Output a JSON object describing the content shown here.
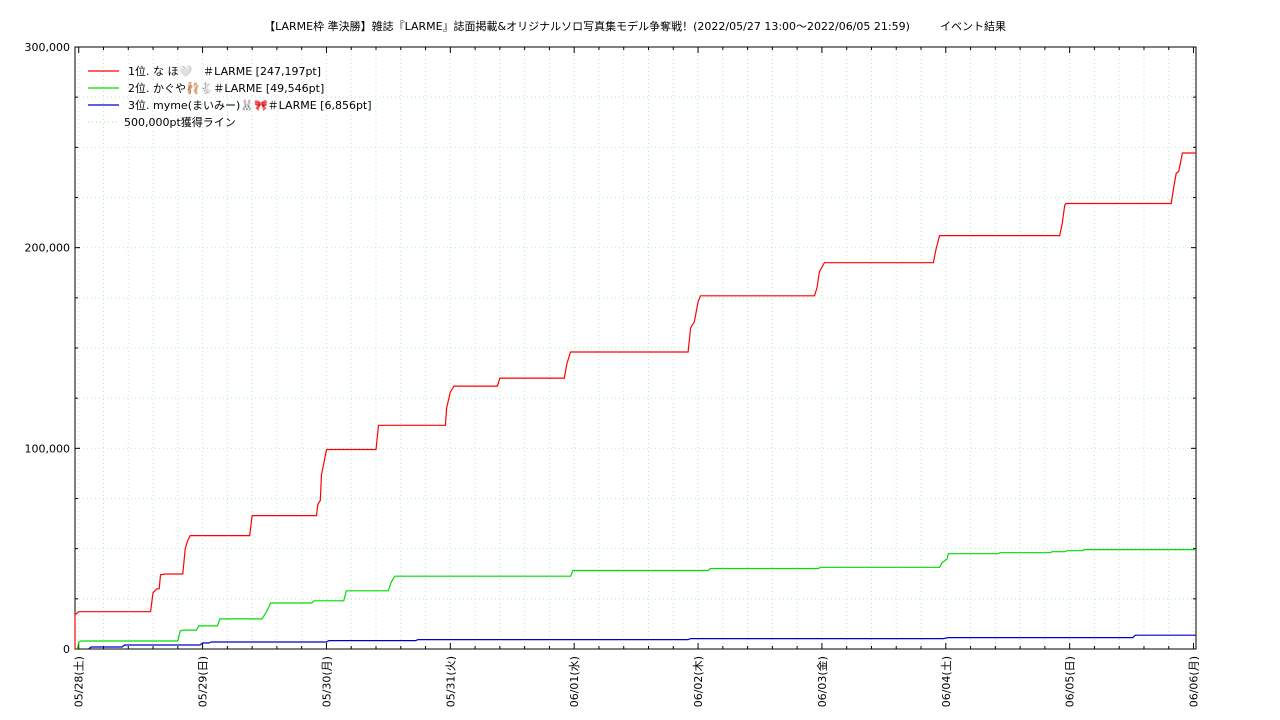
{
  "chart_data": {
    "type": "line",
    "title": "【LARME枠 準決勝】雑誌『LARME』誌面掲載&オリジナルソロ写真集モデル争奪戦！(2022/05/27 13:00～2022/06/05 21:59)",
    "subtitle": "イベント結果",
    "xlabel": "",
    "ylabel": "",
    "ylim": [
      0,
      300000
    ],
    "xlim": [
      -0.03,
      9.02
    ],
    "x_tick_labels": [
      "05/28(土)",
      "05/29(日)",
      "05/30(月)",
      "05/31(火)",
      "06/01(水)",
      "06/02(木)",
      "06/03(金)",
      "06/04(土)",
      "06/05(日)",
      "06/06(月)"
    ],
    "y_ticks": [
      0,
      100000,
      200000,
      300000
    ],
    "y_tick_labels": [
      "0",
      "100,000",
      "200,000",
      "300,000"
    ],
    "grid": true,
    "legend_position": "top-left",
    "series": [
      {
        "name": "1位. な ほ🤍　＃LARME [247,197pt]",
        "color": "#ff0000",
        "points": [
          [
            -0.06,
            0
          ],
          [
            -0.05,
            12000
          ],
          [
            -0.03,
            17000
          ],
          [
            0.0,
            18600
          ],
          [
            0.58,
            18600
          ],
          [
            0.6,
            28000
          ],
          [
            0.63,
            30000
          ],
          [
            0.65,
            30000
          ],
          [
            0.66,
            37000
          ],
          [
            0.7,
            37400
          ],
          [
            0.84,
            37400
          ],
          [
            0.86,
            50000
          ],
          [
            0.88,
            54000
          ],
          [
            0.9,
            56500
          ],
          [
            1.38,
            56500
          ],
          [
            1.4,
            66500
          ],
          [
            1.92,
            66500
          ],
          [
            1.93,
            72000
          ],
          [
            1.95,
            74000
          ],
          [
            1.96,
            87000
          ],
          [
            1.98,
            93000
          ],
          [
            2.0,
            99400
          ],
          [
            2.4,
            99400
          ],
          [
            2.42,
            111500
          ],
          [
            2.96,
            111500
          ],
          [
            2.97,
            120000
          ],
          [
            3.0,
            128000
          ],
          [
            3.03,
            131000
          ],
          [
            3.38,
            131000
          ],
          [
            3.4,
            135000
          ],
          [
            3.92,
            135000
          ],
          [
            3.94,
            142000
          ],
          [
            3.97,
            148000
          ],
          [
            4.92,
            148000
          ],
          [
            4.94,
            160000
          ],
          [
            4.97,
            163000
          ],
          [
            5.0,
            173000
          ],
          [
            5.02,
            176000
          ],
          [
            5.94,
            176000
          ],
          [
            5.96,
            180000
          ],
          [
            5.98,
            188000
          ],
          [
            6.02,
            192500
          ],
          [
            6.9,
            192500
          ],
          [
            6.92,
            199000
          ],
          [
            6.95,
            206000
          ],
          [
            7.92,
            206000
          ],
          [
            7.94,
            212000
          ],
          [
            7.96,
            221000
          ],
          [
            7.97,
            222000
          ],
          [
            8.82,
            222000
          ],
          [
            8.84,
            230000
          ],
          [
            8.86,
            237000
          ],
          [
            8.88,
            238000
          ],
          [
            8.91,
            247200
          ],
          [
            9.02,
            247200
          ]
        ]
      },
      {
        "name": "2位. かぐや🩰🐇＃LARME [49,546pt]",
        "color": "#00dd00",
        "points": [
          [
            -0.01,
            0
          ],
          [
            0.0,
            3500
          ],
          [
            0.02,
            4000
          ],
          [
            0.8,
            4000
          ],
          [
            0.82,
            9000
          ],
          [
            0.85,
            9400
          ],
          [
            0.95,
            9400
          ],
          [
            0.97,
            11500
          ],
          [
            1.12,
            11500
          ],
          [
            1.14,
            15000
          ],
          [
            1.48,
            15000
          ],
          [
            1.52,
            19000
          ],
          [
            1.55,
            22900
          ],
          [
            1.88,
            22900
          ],
          [
            1.9,
            24000
          ],
          [
            2.14,
            24000
          ],
          [
            2.16,
            29000
          ],
          [
            2.5,
            29000
          ],
          [
            2.52,
            33000
          ],
          [
            2.55,
            36300
          ],
          [
            3.97,
            36300
          ],
          [
            3.99,
            39100
          ],
          [
            5.08,
            39100
          ],
          [
            5.1,
            40100
          ],
          [
            5.97,
            40100
          ],
          [
            5.99,
            40700
          ],
          [
            6.95,
            40700
          ],
          [
            6.97,
            43000
          ],
          [
            7.01,
            44800
          ],
          [
            7.02,
            47500
          ],
          [
            7.42,
            47500
          ],
          [
            7.44,
            48000
          ],
          [
            7.84,
            48000
          ],
          [
            7.86,
            48500
          ],
          [
            7.96,
            48500
          ],
          [
            7.98,
            49000
          ],
          [
            8.1,
            49000
          ],
          [
            8.12,
            49546
          ],
          [
            9.02,
            49546
          ]
        ]
      },
      {
        "name": "3位. myme(まいみー)🐰🎀＃LARME [6,856pt]",
        "color": "#0000cc",
        "points": [
          [
            0.08,
            0
          ],
          [
            0.1,
            1000
          ],
          [
            0.35,
            1000
          ],
          [
            0.37,
            2000
          ],
          [
            0.98,
            2000
          ],
          [
            1.0,
            3000
          ],
          [
            1.05,
            3000
          ],
          [
            1.07,
            3500
          ],
          [
            2.0,
            3500
          ],
          [
            2.02,
            4200
          ],
          [
            2.72,
            4200
          ],
          [
            2.74,
            4700
          ],
          [
            4.92,
            4700
          ],
          [
            4.94,
            5200
          ],
          [
            6.98,
            5200
          ],
          [
            7.02,
            5700
          ],
          [
            8.51,
            5700
          ],
          [
            8.53,
            6856
          ],
          [
            9.02,
            6856
          ]
        ]
      },
      {
        "name": "500,000pt獲得ライン",
        "color": "#99ee99",
        "dashed": true,
        "points": []
      }
    ]
  }
}
